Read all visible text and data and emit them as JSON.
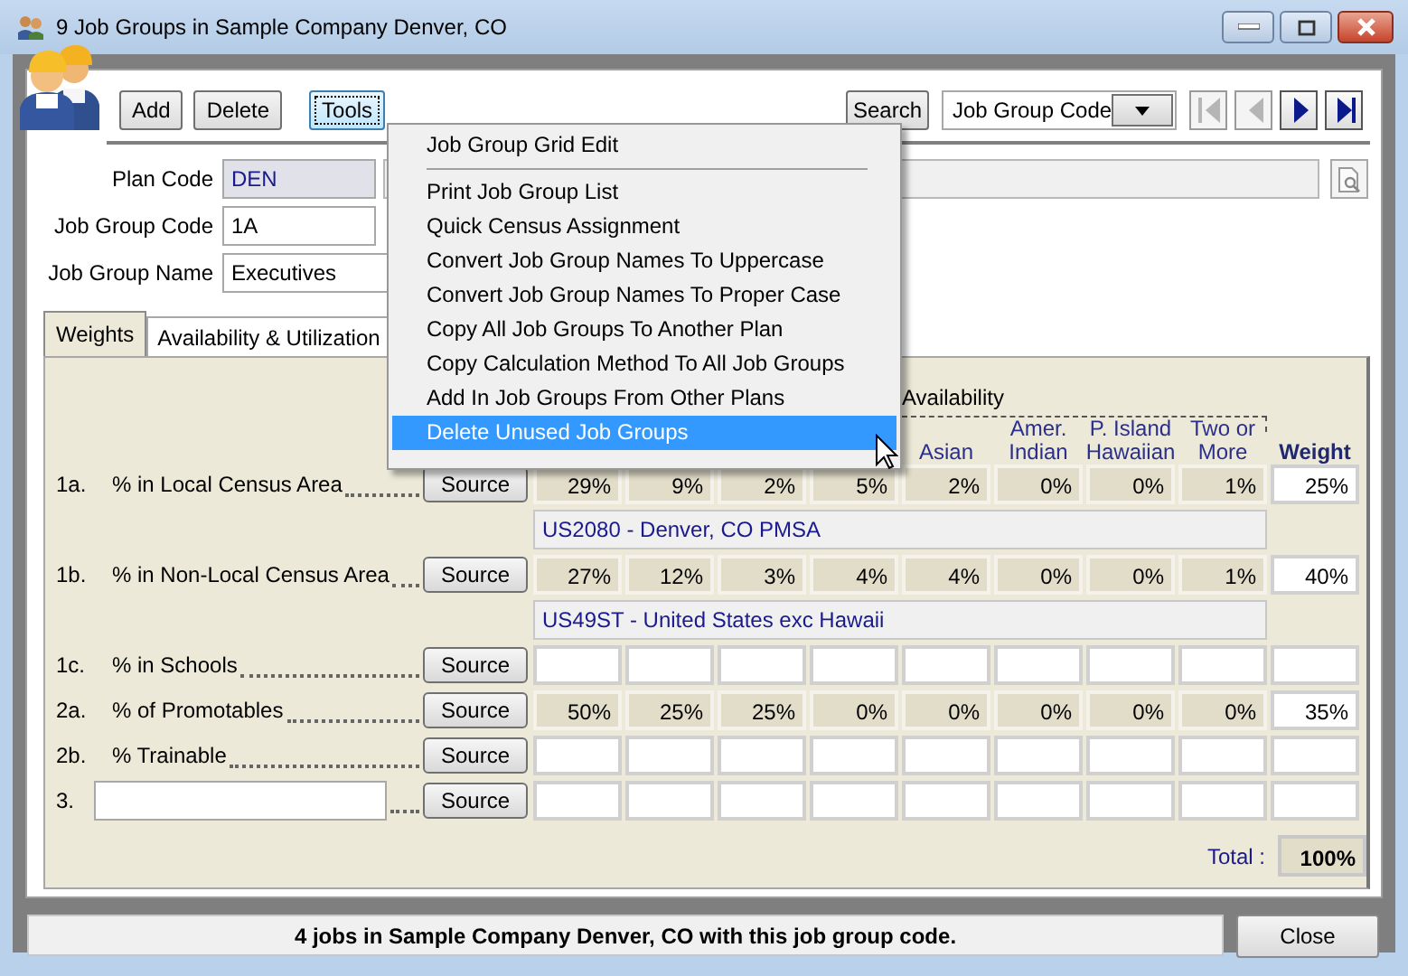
{
  "window": {
    "title": "9 Job Groups in Sample Company Denver, CO"
  },
  "toolbar": {
    "buttons": [
      {
        "label": "Add",
        "focused": false
      },
      {
        "label": "Delete",
        "focused": false
      },
      {
        "label": "Tools",
        "focused": true
      }
    ],
    "search_button": "Search",
    "sort_field": {
      "value": "Job Group Code"
    },
    "nav": [
      {
        "kind": "first",
        "disabled": true
      },
      {
        "kind": "prev",
        "disabled": true
      },
      {
        "kind": "next",
        "disabled": false
      },
      {
        "kind": "last",
        "disabled": false
      }
    ]
  },
  "fields": [
    {
      "label": "Plan Code",
      "value": "DEN",
      "kind": "readonly"
    },
    {
      "label": "Job Group Code",
      "value": "1A",
      "kind": "text"
    },
    {
      "label": "Job Group Name",
      "value": "Executives",
      "kind": "text"
    }
  ],
  "tabs": [
    {
      "label": "Weights",
      "selected": true
    },
    {
      "label": "Availability & Utilization",
      "selected": false
    }
  ],
  "weights": {
    "group_heading": "Availability",
    "column_headers": [
      "Asian",
      "Amer. Indian",
      "P. Island Hawaiian",
      "Two or More"
    ],
    "weight_heading": "Weight",
    "rows": [
      {
        "kind": "label",
        "number": "1a.",
        "label": "% in Local Census Area",
        "source": "Source",
        "values": [
          "29%",
          "9%",
          "2%",
          "5%",
          "2%",
          "0%",
          "0%",
          "1%"
        ],
        "weight": "25%",
        "census": "US2080 - Denver, CO PMSA"
      },
      {
        "kind": "label",
        "number": "1b.",
        "label": "% in Non-Local Census Area",
        "source": "Source",
        "values": [
          "27%",
          "12%",
          "3%",
          "4%",
          "4%",
          "0%",
          "0%",
          "1%"
        ],
        "weight": "40%",
        "census": "US49ST - United States exc Hawaii"
      },
      {
        "kind": "label",
        "number": "1c.",
        "label": "% in Schools",
        "source": "Source"
      },
      {
        "kind": "label",
        "number": "2a.",
        "label": "% of Promotables",
        "source": "Source",
        "values": [
          "50%",
          "25%",
          "25%",
          "0%",
          "0%",
          "0%",
          "0%",
          "0%"
        ],
        "weight": "35%"
      },
      {
        "kind": "label",
        "number": "2b.",
        "label": "% Trainable",
        "source": "Source"
      },
      {
        "kind": "input",
        "number": "3.",
        "source": "Source"
      }
    ],
    "total_label": "Total :",
    "total": "100%"
  },
  "tools_menu": {
    "open": true,
    "items": [
      {
        "label": "Job Group Grid Edit",
        "separator_after": true,
        "selected": false
      },
      {
        "label": "Print Job Group List",
        "separator_after": false,
        "selected": false
      },
      {
        "label": "Quick Census Assignment",
        "separator_after": false,
        "selected": false
      },
      {
        "label": "Convert Job Group Names To Uppercase",
        "separator_after": false,
        "selected": false
      },
      {
        "label": "Convert Job Group Names To Proper Case",
        "separator_after": false,
        "selected": false
      },
      {
        "label": "Copy All Job Groups To Another Plan",
        "separator_after": false,
        "selected": false
      },
      {
        "label": "Copy Calculation Method To All Job Groups",
        "separator_after": false,
        "selected": false
      },
      {
        "label": "Add In Job Groups From Other Plans",
        "separator_after": false,
        "selected": false
      },
      {
        "label": "Delete Unused Job Groups",
        "separator_after": false,
        "selected": true
      }
    ]
  },
  "status_bar": {
    "text": "4 jobs in Sample Company Denver, CO with this job group code.",
    "close_button": "Close"
  }
}
